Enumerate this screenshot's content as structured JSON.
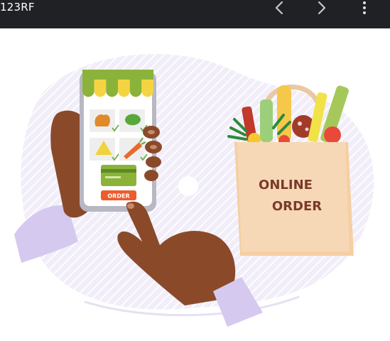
{
  "topbar": {
    "brand": "123RF",
    "prev_icon": "chevron-left-icon",
    "next_icon": "chevron-right-icon",
    "more_icon": "more-vertical-icon"
  },
  "illustration": {
    "bag": {
      "line1": "ONLINE",
      "line2": "ORDER"
    },
    "phone": {
      "button_label": "ORDER"
    }
  },
  "colors": {
    "topbar": "#202124",
    "bag": "#f7d8b6",
    "skin": "#8a4a2a",
    "blob": "#ebe6f6",
    "awning_green": "#8bb33a",
    "awning_yellow": "#f5d443",
    "order_button": "#ee5b2c"
  }
}
